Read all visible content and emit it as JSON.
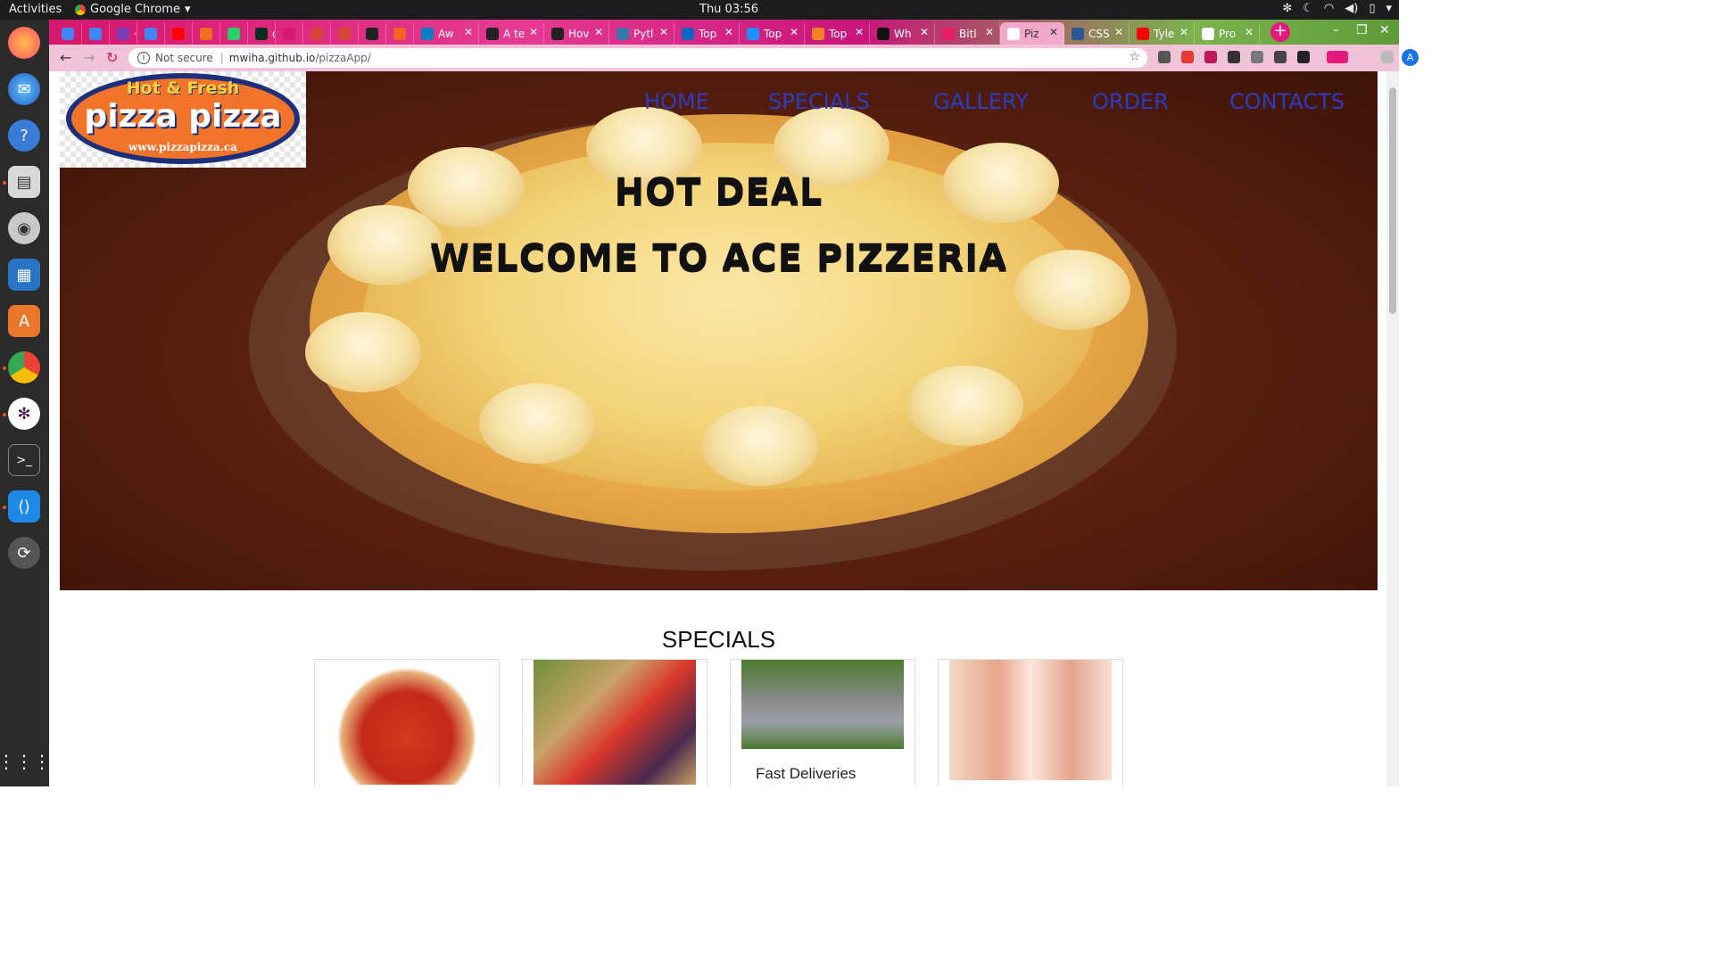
{
  "os": {
    "activities": "Activities",
    "app_name": "Google Chrome",
    "clock": "Thu 03:56"
  },
  "browser": {
    "tabs": [
      {
        "label": ""
      },
      {
        "label": ""
      },
      {
        "label": "·h"
      },
      {
        "label": ""
      },
      {
        "label": ""
      },
      {
        "label": ""
      },
      {
        "label": ""
      },
      {
        "label": "dj"
      },
      {
        "label": ""
      },
      {
        "label": ""
      },
      {
        "label": ""
      },
      {
        "label": ""
      },
      {
        "label": ""
      },
      {
        "label": "Aw"
      },
      {
        "label": "A te"
      },
      {
        "label": "Hov"
      },
      {
        "label": "Pytl"
      },
      {
        "label": "Top"
      },
      {
        "label": "Top"
      },
      {
        "label": "Top"
      },
      {
        "label": "Wh"
      },
      {
        "label": "Bitl"
      },
      {
        "label": "Piz"
      },
      {
        "label": "CSS"
      },
      {
        "label": "Tyle"
      },
      {
        "label": "Pro"
      }
    ],
    "address": {
      "security": "Not secure",
      "host": "mwiha.github.io",
      "path": "/pizzaApp/"
    },
    "avatar_letter": "A"
  },
  "site": {
    "logo": {
      "top": "Hot & Fresh",
      "main": "pizza pizza",
      "url": "www.pizzapizza.ca"
    },
    "nav": [
      "HOME",
      "SPECIALS",
      "GALLERY",
      "ORDER",
      "CONTACTS"
    ],
    "hero": {
      "line1": "HOT DEAL",
      "line2": "WELCOME TO ACE PIZZERIA"
    },
    "specials": {
      "title": "SPECIALS",
      "cards": [
        {
          "label": "",
          "image": "pizza-image"
        },
        {
          "label": "",
          "image": "vegetables-image"
        },
        {
          "label": "Fast Deliveries",
          "image": "delivery-image"
        },
        {
          "label": "",
          "image": "kids-eating-image"
        }
      ]
    }
  },
  "colors": {
    "nav_link": "#2e3cbf",
    "tabstrip": "#d6176d",
    "toolbar": "#f1c3d9"
  }
}
